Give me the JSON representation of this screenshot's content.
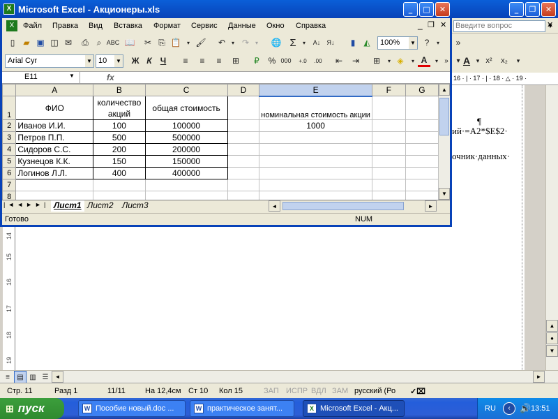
{
  "word": {
    "ask_placeholder": "Введите вопрос",
    "ruler_text": "16 · | · 17 · | · 18 · △ · 19 ·",
    "formula_text": "ий·=A2*$E$2·",
    "source_text": "очник·данных·",
    "pilcrow": "¶",
    "vruler_numbers": [
      "14",
      "15",
      "16",
      "17",
      "18",
      "19"
    ],
    "status": {
      "page": "Стр. 11",
      "section": "Разд 1",
      "pages": "11/11",
      "at": "На 12,4см",
      "line": "Ст 10",
      "col": "Кол 15",
      "rec": "ЗАП",
      "trk": "ИСПР",
      "ext": "ВДЛ",
      "ovr": "ЗАМ",
      "lang": "русский (Ро"
    }
  },
  "excel": {
    "title": "Microsoft Excel - Акционеры.xls",
    "menu": [
      "Файл",
      "Правка",
      "Вид",
      "Вставка",
      "Формат",
      "Сервис",
      "Данные",
      "Окно",
      "Справка"
    ],
    "zoom": "100%",
    "font_name": "Arial Cyr",
    "font_size": "10",
    "name_box": "E11",
    "fx": "fx",
    "columns": [
      "A",
      "B",
      "C",
      "D",
      "E",
      "F",
      "G"
    ],
    "rows": [
      {
        "n": "1",
        "cells": [
          "ФИО",
          "количество акций",
          "общая стоимость",
          "",
          "номинальная стоимость акции",
          "",
          ""
        ]
      },
      {
        "n": "2",
        "cells": [
          "Иванов И.И.",
          "100",
          "100000",
          "",
          "1000",
          "",
          ""
        ]
      },
      {
        "n": "3",
        "cells": [
          "Петров П.П.",
          "500",
          "500000",
          "",
          "",
          "",
          ""
        ]
      },
      {
        "n": "4",
        "cells": [
          "Сидоров С.С.",
          "200",
          "200000",
          "",
          "",
          "",
          ""
        ]
      },
      {
        "n": "5",
        "cells": [
          "Кузнецов К.К.",
          "150",
          "150000",
          "",
          "",
          "",
          ""
        ]
      },
      {
        "n": "6",
        "cells": [
          "Логинов Л.Л.",
          "400",
          "400000",
          "",
          "",
          "",
          ""
        ]
      },
      {
        "n": "7",
        "cells": [
          "",
          "",
          "",
          "",
          "",
          "",
          ""
        ]
      },
      {
        "n": "8",
        "cells": [
          "",
          "",
          "",
          "",
          "",
          "",
          ""
        ]
      }
    ],
    "sheets": [
      "Лист1",
      "Лист2",
      "Лист3"
    ],
    "status_ready": "Готово",
    "status_num": "NUM"
  },
  "taskbar": {
    "start": "пуск",
    "buttons": [
      "Пособие новый.doc ...",
      "практическое занят...",
      "Microsoft Excel - Акц..."
    ],
    "lang": "RU",
    "clock": "13:51"
  }
}
